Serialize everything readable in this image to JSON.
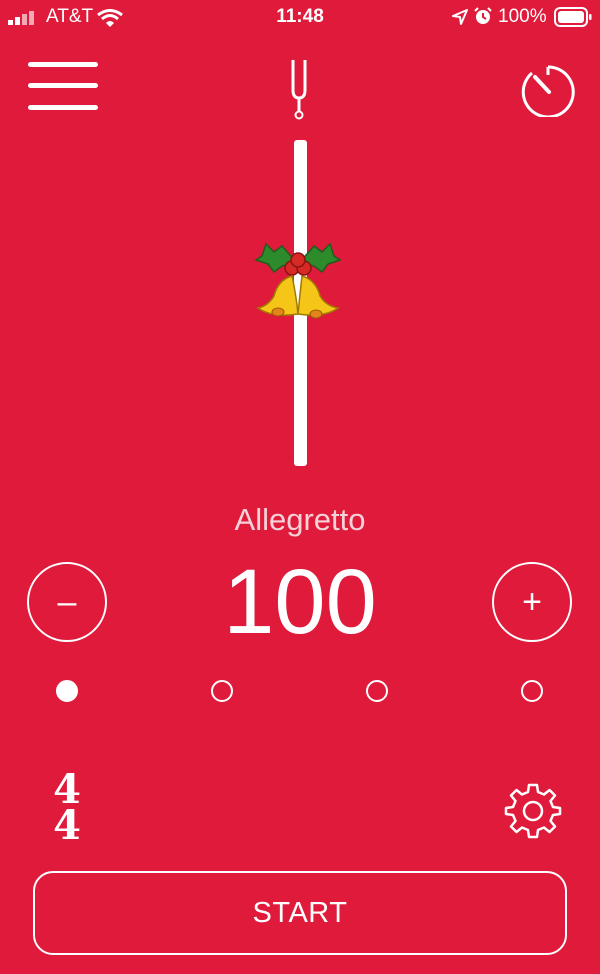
{
  "status_bar": {
    "carrier": "AT&T",
    "time": "11:48",
    "battery": "100%"
  },
  "toolbar": {
    "menu_icon": "hamburger-menu-icon",
    "tuner_icon": "tuning-fork-icon",
    "timer_icon": "stopwatch-icon"
  },
  "pendulum": {
    "weight_icon": "christmas-bells-icon"
  },
  "tempo": {
    "marking": "Allegretto",
    "bpm": "100",
    "decrease_label": "–",
    "increase_label": "+"
  },
  "beats": {
    "count": 4,
    "active_index": 0
  },
  "time_signature": {
    "numerator": "4",
    "denominator": "4"
  },
  "controls": {
    "settings_icon": "gear-icon",
    "start_label": "START"
  }
}
